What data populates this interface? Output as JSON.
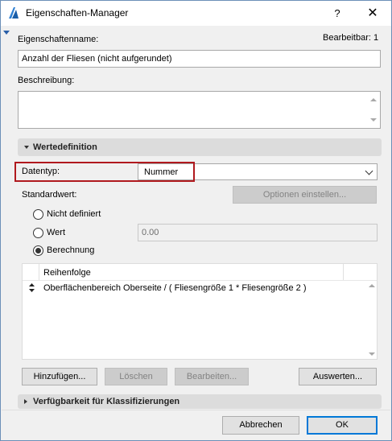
{
  "window": {
    "title": "Eigenschaften-Manager",
    "help_label": "?",
    "close_label": "✕"
  },
  "property": {
    "name_label": "Eigenschaftenname:",
    "editable_label": "Bearbeitbar: 1",
    "name_value": "Anzahl der Fliesen (nicht aufgerundet)",
    "description_label": "Beschreibung:",
    "description_value": ""
  },
  "value_definition": {
    "section_title": "Wertedefinition",
    "datatype_label": "Datentyp:",
    "datatype_value": "Nummer",
    "default_label": "Standardwert:",
    "options_button": "Optionen einstellen...",
    "radio_undefined": "Nicht definiert",
    "radio_value": "Wert",
    "value_field": "0.00",
    "radio_calculation": "Berechnung",
    "selected_radio": "Berechnung",
    "formula_header": "Reihenfolge",
    "formula_row": "Oberflächenbereich Oberseite / ( Fliesengröße 1 * Fliesengröße 2 )",
    "buttons": {
      "add": "Hinzufügen...",
      "delete": "Löschen",
      "edit": "Bearbeiten...",
      "evaluate": "Auswerten..."
    }
  },
  "availability": {
    "section_title": "Verfügbarkeit für Klassifizierungen"
  },
  "footer": {
    "cancel": "Abbrechen",
    "ok": "OK"
  },
  "colors": {
    "accent": "#0078d7",
    "highlight_border": "#b0191e",
    "section_bar": "#dcdcdc"
  }
}
